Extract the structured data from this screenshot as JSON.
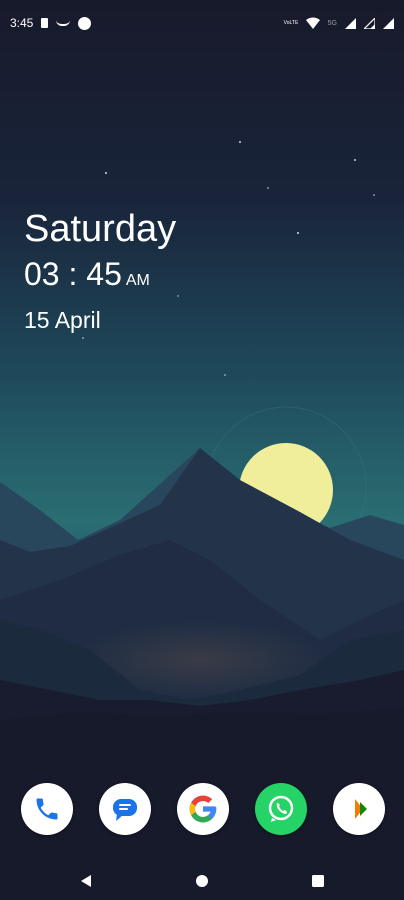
{
  "status_bar": {
    "time": "3:45",
    "icons_left": [
      "sim-icon",
      "missed-call-icon",
      "dot-icon"
    ],
    "volte_label": "VoLTE",
    "network_label": "5G",
    "icons_right": [
      "volte-icon",
      "wifi-icon",
      "5g-icon",
      "signal-icon",
      "signal-icon-2",
      "battery-icon"
    ]
  },
  "clock_widget": {
    "day": "Saturday",
    "time": "03 : 45",
    "ampm": "AM",
    "date": "15 April"
  },
  "dock": {
    "apps": [
      {
        "name": "Phone",
        "icon": "phone-icon",
        "color": "#1a73e8"
      },
      {
        "name": "Messages",
        "icon": "messages-icon",
        "color": "#1a73e8"
      },
      {
        "name": "Google",
        "icon": "google-icon",
        "color": "#4285f4"
      },
      {
        "name": "WhatsApp",
        "icon": "whatsapp-icon",
        "color": "#25d366"
      },
      {
        "name": "BHIM",
        "icon": "bhim-icon",
        "color": "#f57c00"
      }
    ]
  },
  "nav_bar": {
    "buttons": [
      "back-icon",
      "home-icon",
      "recents-icon"
    ]
  },
  "wallpaper": {
    "sky_top": "#171a2b",
    "sky_mid": "#1f4f5e",
    "moon": "#f0ee9a",
    "mountain_dark": "#1a1f33"
  }
}
